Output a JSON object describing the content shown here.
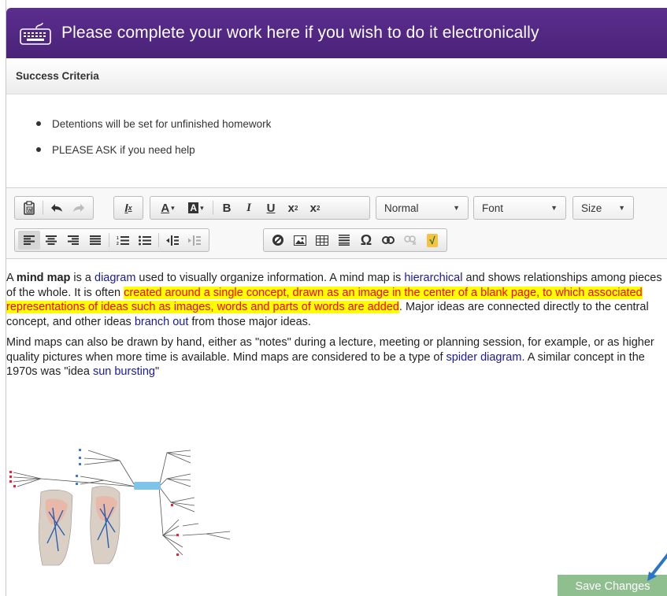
{
  "header": {
    "title": "Please complete your work here if you wish to do it electronically"
  },
  "section": {
    "title": "Success Criteria"
  },
  "criteria": [
    "Detentions will be set for unfinished homework",
    "PLEASE ASK if you need help"
  ],
  "toolbar": {
    "format_value": "Normal",
    "font_value": "Font",
    "size_value": "Size",
    "icons_row1": [
      "paste-from-word-icon",
      "undo-icon",
      "redo-icon",
      "remove-format-icon",
      "text-color-icon",
      "background-color-icon",
      "bold-icon",
      "italic-icon",
      "underline-icon",
      "subscript-icon",
      "superscript-icon"
    ],
    "icons_row2": [
      "align-left-icon",
      "align-center-icon",
      "align-right-icon",
      "justify-icon",
      "numbered-list-icon",
      "bulleted-list-icon",
      "decrease-indent-icon",
      "increase-indent-icon",
      "anchor-icon",
      "image-icon",
      "table-icon",
      "horizontal-line-icon",
      "special-character-icon",
      "link-icon",
      "unlink-icon",
      "math-icon"
    ],
    "glyphs": {
      "remove_format": "I",
      "text_color": "A",
      "bg_color": "A",
      "bold": "B",
      "italic": "I",
      "underline": "U",
      "subscript": "x",
      "superscript": "x",
      "omega": "Ω",
      "math": "√"
    }
  },
  "content": {
    "p1": {
      "t1": "A ",
      "bold": "mind map",
      "t2": " is a ",
      "link1": "diagram",
      "t3": " used to visually organize information. A mind map is ",
      "link2": "hierarchical",
      "t4": " and shows relationships among pieces of the whole. It is often ",
      "highlight": "created around a single concept, drawn as an image in the center of a blank page, to which associated representations of ideas such as images, words and parts of words are added",
      "t5": ". Major ideas are connected directly to the central concept, and other ideas ",
      "link3": "branch out",
      "t6": " from those major ideas."
    },
    "p2": {
      "t1": "Mind maps can also be drawn by hand, either as \"notes\" during a lecture, meeting or planning session, for example, or as higher quality pictures when more time is available. Mind maps are considered to be a type of ",
      "link1": "spider diagram",
      "t2": ". A similar concept in the 1970s was \"idea ",
      "link2": "sun bursting",
      "t3": "\""
    }
  },
  "save_button": {
    "label": "Save Changes"
  },
  "colors": {
    "header": "#4f2680",
    "highlight_bg": "#ffff00",
    "highlight_text": "#ff0000",
    "link": "#1a1a9a",
    "save_button": "#8fbe8f"
  }
}
